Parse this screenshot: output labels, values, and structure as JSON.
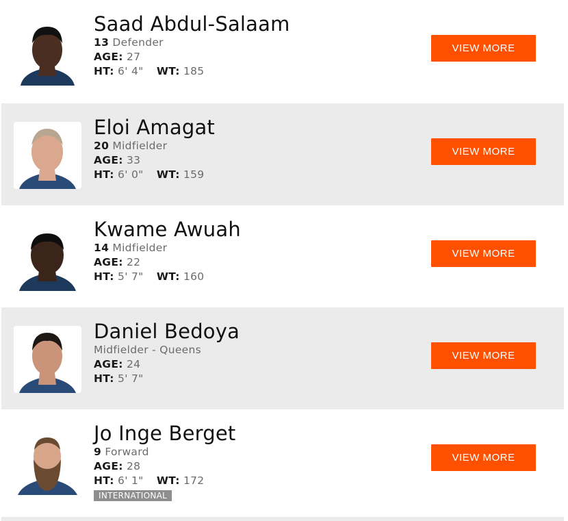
{
  "labels": {
    "age": "AGE:",
    "ht": "HT:",
    "wt": "WT:"
  },
  "players": [
    {
      "name": "Saad Abdul-Salaam",
      "number": "13",
      "position": "Defender",
      "age": "27",
      "height": "6' 4\"",
      "weight": "185",
      "button": "VIEW MORE",
      "skin": "#4a2e22",
      "hair": "#111111"
    },
    {
      "name": "Eloi Amagat",
      "number": "20",
      "position": "Midfielder",
      "age": "33",
      "height": "6' 0\"",
      "weight": "159",
      "button": "VIEW MORE",
      "skin": "#d9a88e",
      "hair": "#b8a690"
    },
    {
      "name": "Kwame Awuah",
      "number": "14",
      "position": "Midfielder",
      "age": "22",
      "height": "5' 7\"",
      "weight": "160",
      "button": "VIEW MORE",
      "skin": "#3b2419",
      "hair": "#0e0e0e"
    },
    {
      "name": "Daniel Bedoya",
      "number": "",
      "position": "Midfielder - Queens",
      "age": "24",
      "height": "5' 7\"",
      "weight": "",
      "button": "VIEW MORE",
      "skin": "#c99479",
      "hair": "#1e1814"
    },
    {
      "name": "Jo Inge Berget",
      "number": "9",
      "position": "Forward",
      "age": "28",
      "height": "6' 1\"",
      "weight": "172",
      "button": "VIEW MORE",
      "tag": "INTERNATIONAL",
      "skin": "#d6a58a",
      "hair": "#6b4a32"
    }
  ]
}
